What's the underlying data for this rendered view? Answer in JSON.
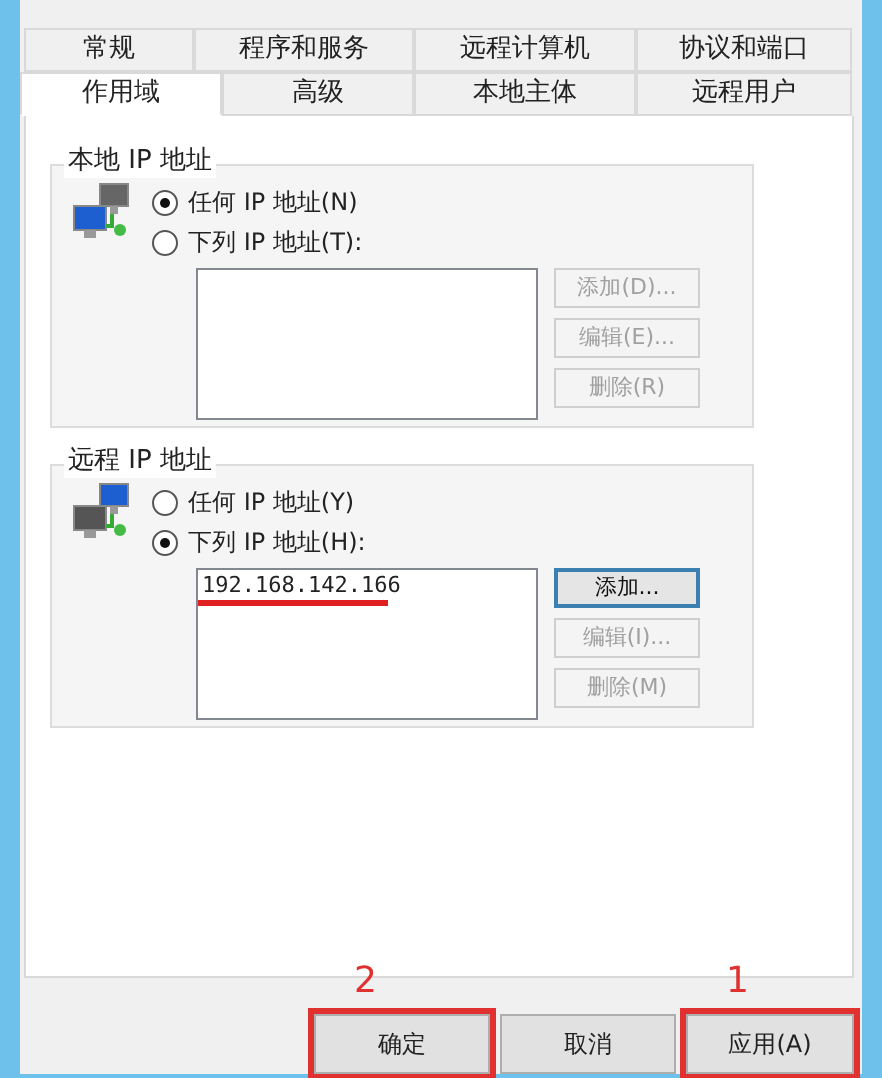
{
  "tabs_row_1": [
    {
      "label": "常规",
      "selected": false
    },
    {
      "label": "程序和服务",
      "selected": false
    },
    {
      "label": "远程计算机",
      "selected": false
    },
    {
      "label": "协议和端口",
      "selected": false
    }
  ],
  "tabs_row_2": [
    {
      "label": "作用域",
      "selected": true
    },
    {
      "label": "高级",
      "selected": false
    },
    {
      "label": "本地主体",
      "selected": false
    },
    {
      "label": "远程用户",
      "selected": false
    }
  ],
  "groups": [
    {
      "title": "本地 IP 地址",
      "options": [
        {
          "label": "任何 IP 地址(N)",
          "selected": true
        },
        {
          "label": "下列 IP 地址(T):",
          "selected": false
        }
      ],
      "buttons": [
        {
          "label": "添加(D)...",
          "disabled": true,
          "focused": false
        },
        {
          "label": "编辑(E)...",
          "disabled": true,
          "focused": false
        },
        {
          "label": "删除(R)",
          "disabled": true,
          "focused": false
        }
      ]
    },
    {
      "title": "远程 IP 地址",
      "options": [
        {
          "label": "任何 IP 地址(Y)",
          "selected": false
        },
        {
          "label": "下列 IP 地址(H):",
          "selected": true
        }
      ],
      "addresses": [
        {
          "text": "192.168.142.166",
          "underlined": true
        }
      ],
      "buttons": [
        {
          "label": "添加...",
          "disabled": false,
          "focused": true
        },
        {
          "label": "编辑(I)...",
          "disabled": true,
          "focused": false
        },
        {
          "label": "删除(M)",
          "disabled": true,
          "focused": false
        }
      ]
    }
  ],
  "dialog_buttons": [
    {
      "label": "确定",
      "annotation": "2"
    },
    {
      "label": "取消"
    },
    {
      "label": "应用(A)",
      "annotation": "1"
    }
  ]
}
